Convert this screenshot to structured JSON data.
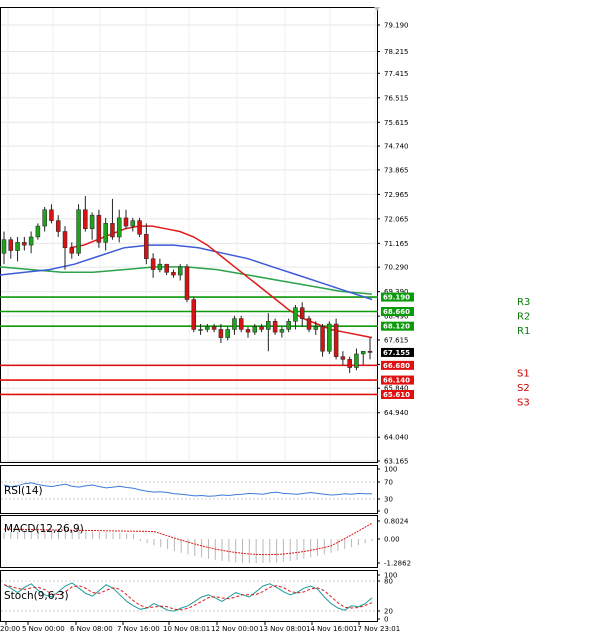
{
  "chart_data": {
    "type": "candlestick",
    "y_axis": {
      "ticks": [
        "79.190",
        "78.215",
        "77.415",
        "76.515",
        "75.615",
        "74.740",
        "73.865",
        "72.965",
        "72.065",
        "71.165",
        "70.290",
        "69.390",
        "68.490",
        "67.615",
        "66.715",
        "65.840",
        "64.940",
        "64.040",
        "63.165"
      ],
      "tick_values": [
        79.19,
        78.215,
        77.415,
        76.515,
        75.615,
        74.74,
        73.865,
        72.965,
        72.065,
        71.165,
        70.29,
        69.39,
        68.49,
        67.615,
        66.715,
        65.84,
        64.94,
        64.04,
        63.165
      ],
      "range": [
        63.0,
        79.9
      ]
    },
    "x_axis": {
      "labels": [
        "20:00",
        "5 Nov 00:00",
        "6 Nov 08:00",
        "7 Nov 16:00",
        "10 Nov 08:01",
        "12 Nov 00:00",
        "13 Nov 08:00",
        "14 Nov 16:00",
        "17 Nov 23:01"
      ]
    },
    "current_price": "67.155",
    "levels": [
      {
        "name": "R3",
        "value": 69.19,
        "badge": "69.190",
        "color": "#0a9a0a"
      },
      {
        "name": "R2",
        "value": 68.66,
        "badge": "68.660",
        "color": "#0a9a0a"
      },
      {
        "name": "R1",
        "value": 68.12,
        "badge": "68.120",
        "color": "#0a9a0a"
      },
      {
        "name": "S1",
        "value": 66.68,
        "badge": "66.680",
        "color": "#e01010"
      },
      {
        "name": "S2",
        "value": 66.14,
        "badge": "66.140",
        "color": "#e01010"
      },
      {
        "name": "S3",
        "value": 65.61,
        "badge": "65.610",
        "color": "#e01010"
      }
    ],
    "candles": [
      [
        70.8,
        71.6,
        70.4,
        71.3
      ],
      [
        71.3,
        71.4,
        70.6,
        70.9
      ],
      [
        70.9,
        71.4,
        70.5,
        71.2
      ],
      [
        71.2,
        71.4,
        70.9,
        71.1
      ],
      [
        71.1,
        71.6,
        70.8,
        71.4
      ],
      [
        71.4,
        71.9,
        71.3,
        71.8
      ],
      [
        71.8,
        72.5,
        71.6,
        72.4
      ],
      [
        72.4,
        72.6,
        71.9,
        72.0
      ],
      [
        72.0,
        72.2,
        71.4,
        71.6
      ],
      [
        71.6,
        71.8,
        70.2,
        71.0
      ],
      [
        71.0,
        71.2,
        70.6,
        70.8
      ],
      [
        70.8,
        72.6,
        70.7,
        72.4
      ],
      [
        72.4,
        72.9,
        71.6,
        71.7
      ],
      [
        71.7,
        72.3,
        71.3,
        72.2
      ],
      [
        72.2,
        72.4,
        71.0,
        71.2
      ],
      [
        71.2,
        72.1,
        70.9,
        71.9
      ],
      [
        71.9,
        72.8,
        71.3,
        71.4
      ],
      [
        71.4,
        72.4,
        71.2,
        72.1
      ],
      [
        72.1,
        72.4,
        71.7,
        71.8
      ],
      [
        71.8,
        72.1,
        71.6,
        72.0
      ],
      [
        72.0,
        72.1,
        71.4,
        71.5
      ],
      [
        71.5,
        71.9,
        70.4,
        70.6
      ],
      [
        70.6,
        70.8,
        69.9,
        70.2
      ],
      [
        70.2,
        70.6,
        70.1,
        70.4
      ],
      [
        70.4,
        70.4,
        70.0,
        70.1
      ],
      [
        70.1,
        70.2,
        69.9,
        70.0
      ],
      [
        70.0,
        70.4,
        69.8,
        70.3
      ],
      [
        70.3,
        70.4,
        69.0,
        69.1
      ],
      [
        69.1,
        69.2,
        67.9,
        68.0
      ],
      [
        68.0,
        68.2,
        67.8,
        68.0
      ],
      [
        68.0,
        68.2,
        67.9,
        68.1
      ],
      [
        68.1,
        68.2,
        67.9,
        68.0
      ],
      [
        68.0,
        68.2,
        67.5,
        67.7
      ],
      [
        67.7,
        68.1,
        67.6,
        68.0
      ],
      [
        68.0,
        68.5,
        67.8,
        68.4
      ],
      [
        68.4,
        68.5,
        67.9,
        68.0
      ],
      [
        68.0,
        68.1,
        67.7,
        67.9
      ],
      [
        67.9,
        68.2,
        67.8,
        68.1
      ],
      [
        68.1,
        68.2,
        67.9,
        68.0
      ],
      [
        68.0,
        68.6,
        67.2,
        68.3
      ],
      [
        68.3,
        68.4,
        67.8,
        67.9
      ],
      [
        67.9,
        68.1,
        67.7,
        68.0
      ],
      [
        68.0,
        68.4,
        67.9,
        68.3
      ],
      [
        68.3,
        68.9,
        68.0,
        68.8
      ],
      [
        68.8,
        69.0,
        68.1,
        68.4
      ],
      [
        68.4,
        68.5,
        67.9,
        68.0
      ],
      [
        68.0,
        68.3,
        67.8,
        68.1
      ],
      [
        68.1,
        68.2,
        67.0,
        67.2
      ],
      [
        67.2,
        68.3,
        67.1,
        68.2
      ],
      [
        68.2,
        68.4,
        66.9,
        67.0
      ],
      [
        67.0,
        67.2,
        66.7,
        66.9
      ],
      [
        66.9,
        67.0,
        66.4,
        66.6
      ],
      [
        66.6,
        67.3,
        66.5,
        67.1
      ],
      [
        67.1,
        67.2,
        66.7,
        67.2
      ],
      [
        67.2,
        67.7,
        66.9,
        67.155
      ]
    ],
    "ma_red": [
      71.0,
      71.1,
      71.3,
      71.5,
      71.7,
      71.8,
      71.8,
      71.7,
      71.6,
      71.4,
      71.1,
      70.7,
      70.3,
      69.9,
      69.5,
      69.1,
      68.7,
      68.4,
      68.2,
      68.0,
      67.9,
      67.8,
      67.7
    ],
    "ma_blue": [
      70.0,
      70.1,
      70.2,
      70.4,
      70.7,
      71.0,
      71.1,
      71.1,
      71.0,
      70.8,
      70.6,
      70.3,
      70.0,
      69.7,
      69.4,
      69.1
    ],
    "ma_green": [
      70.3,
      70.2,
      70.1,
      70.1,
      70.2,
      70.3,
      70.3,
      70.2,
      70.0,
      69.8,
      69.6,
      69.4,
      69.3
    ],
    "indicators": {
      "rsi": {
        "label": "RSI(14)",
        "ticks": [
          "100",
          "70",
          "30",
          "0"
        ]
      },
      "macd": {
        "label": "MACD(12,26,9)",
        "ticks": [
          "0.8024",
          "0.00",
          "-1.2862"
        ]
      },
      "stoch": {
        "label": "Stoch(9,6,3)",
        "ticks": [
          "100",
          "80",
          "20",
          "0"
        ]
      }
    }
  }
}
